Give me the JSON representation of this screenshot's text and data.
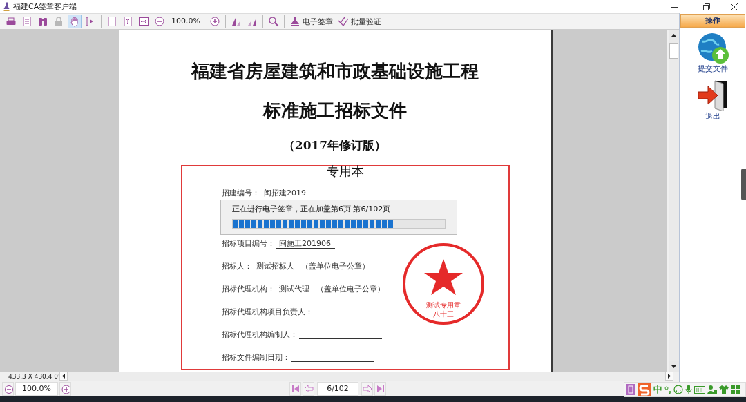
{
  "window": {
    "title": "福建CA签章客户端"
  },
  "toolbar": {
    "groups": [
      [
        {
          "kind": "print",
          "selected": false,
          "disabled": false
        },
        {
          "kind": "pages",
          "selected": false,
          "disabled": false
        },
        {
          "kind": "find",
          "selected": false,
          "disabled": false
        },
        {
          "kind": "lock",
          "selected": false,
          "disabled": true
        },
        {
          "kind": "hand",
          "selected": true,
          "disabled": false
        },
        {
          "kind": "select",
          "selected": false,
          "disabled": false
        }
      ],
      [
        {
          "kind": "single-page",
          "selected": false,
          "disabled": false
        },
        {
          "kind": "fit-height",
          "selected": false,
          "disabled": false
        },
        {
          "kind": "fit-width",
          "selected": false,
          "disabled": false
        },
        {
          "kind": "zoom-out",
          "selected": false,
          "disabled": false
        },
        {
          "kind": "zoom-value",
          "label": "100.0%"
        },
        {
          "kind": "zoom-in",
          "selected": false,
          "disabled": false
        }
      ],
      [
        {
          "kind": "rotate-left",
          "selected": false,
          "disabled": false
        },
        {
          "kind": "rotate-right",
          "selected": false,
          "disabled": false
        }
      ],
      [
        {
          "kind": "search",
          "selected": false,
          "disabled": false
        }
      ],
      [
        {
          "kind": "stamp",
          "label": "电子签章",
          "selected": false,
          "disabled": false
        },
        {
          "kind": "verify",
          "label": "批量验证",
          "selected": false,
          "disabled": false
        }
      ]
    ]
  },
  "document": {
    "title_lines": [
      "福建省房屋建筑和市政基础设施工程",
      "标准施工招标文件"
    ],
    "edition": "（2017年修订版）",
    "section": "专用本",
    "fields": [
      {
        "label": "招建编号：",
        "value": "闽招建2019"
      },
      {
        "label": "招标项目编号：",
        "value": "闽施工201906"
      },
      {
        "label": "招标人：",
        "value": "测试招标人",
        "note": "（盖单位电子公章）"
      },
      {
        "label": "招标代理机构：",
        "value": "测试代理",
        "note": "（盖单位电子公章）"
      },
      {
        "label": "招标代理机构项目负责人："
      },
      {
        "label": "招标代理机构编制人："
      },
      {
        "label": "招标文件编制日期："
      }
    ],
    "seal": {
      "name": "测试专用章",
      "code": "八十三"
    }
  },
  "progress": {
    "message": "正在进行电子签章，正在加盖第6页 第6/102页",
    "level": 0.76
  },
  "status_bar": {
    "coords": "433.3 X 430.4 0'",
    "zoom": "100.0%",
    "page": "6/102"
  },
  "side_panel": {
    "header": "操作",
    "items": [
      {
        "kind": "submit",
        "label": "提交文件"
      },
      {
        "kind": "exit",
        "label": "退出"
      }
    ]
  },
  "ime": {
    "mode": "中"
  }
}
